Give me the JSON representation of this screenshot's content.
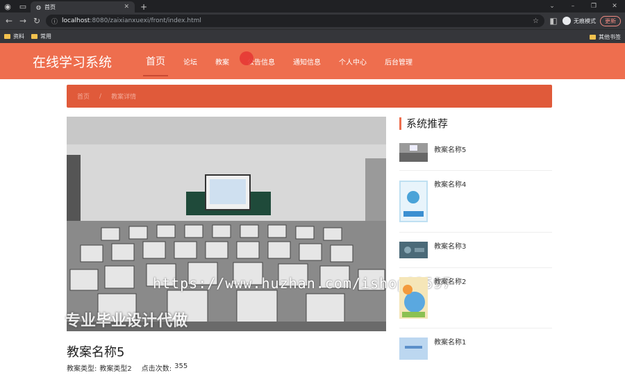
{
  "browser": {
    "tab_title": "首页",
    "url_host": "localhost",
    "url_rest": ":8080/zaixianxuexi/front/index.html",
    "incognito_label": "无痕模式",
    "update_label": "更新",
    "bookmarks": [
      "资料",
      "常用"
    ],
    "other_bookmarks": "其他书签"
  },
  "site": {
    "title": "在线学习系统",
    "nav": [
      "首页",
      "论坛",
      "教案",
      "公告信息",
      "通知信息",
      "个人中心",
      "后台管理"
    ]
  },
  "breadcrumb": {
    "home": "首页",
    "separator": "/",
    "current": "教案详情"
  },
  "detail": {
    "title": "教案名称5",
    "type_label": "教案类型:",
    "type_value": "教案类型2",
    "clicks_label": "点击次数:",
    "clicks_value": "355"
  },
  "watermark": {
    "url": "https://www.huzhan.com/ishop83597",
    "text": "专业毕业设计代做"
  },
  "sidebar": {
    "heading": "系统推荐",
    "items": [
      "教案名称5",
      "教案名称4",
      "教案名称3",
      "教案名称2",
      "教案名称1"
    ]
  },
  "colors": {
    "primary": "#ee6e4e",
    "breadcrumb": "#e05a3a"
  }
}
